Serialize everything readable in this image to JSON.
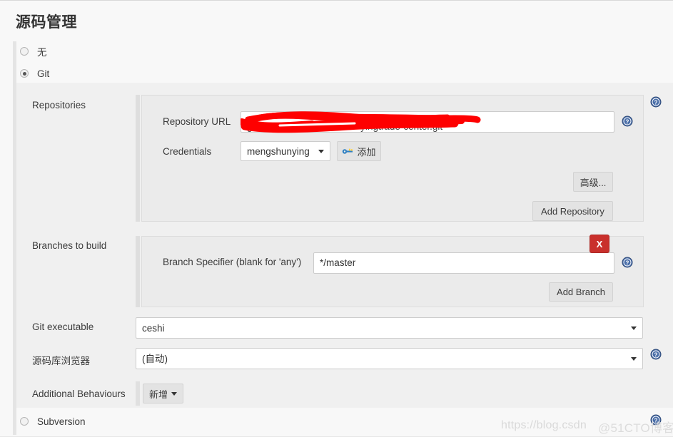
{
  "page": {
    "title": "源码管理"
  },
  "scm_options": [
    {
      "label": "无",
      "checked": false
    },
    {
      "label": "Git",
      "checked": true
    },
    {
      "label": "Subversion",
      "checked": false
    }
  ],
  "git": {
    "repositories_label": "Repositories",
    "repository": {
      "url_label": "Repository URL",
      "url_value": "git@*************************yingtrade-center.git",
      "url_redacted": true,
      "credentials_label": "Credentials",
      "credentials_value": "mengshunying",
      "add_credentials_label": "添加",
      "add_credentials_icon": "key-icon",
      "advanced_label": "高级...",
      "add_repository_label": "Add Repository"
    },
    "branches": {
      "section_label": "Branches to build",
      "specifier_label": "Branch Specifier (blank for 'any')",
      "specifier_value": "*/master",
      "delete_label": "X",
      "add_branch_label": "Add Branch"
    },
    "git_executable": {
      "label": "Git executable",
      "value": "ceshi"
    },
    "repository_browser": {
      "label": "源码库浏览器",
      "value": "(自动)"
    },
    "additional_behaviours": {
      "label": "Additional Behaviours",
      "add_label": "新增"
    }
  },
  "help_icon_name": "help-icon",
  "watermark": {
    "left_text": "https://blog.csdn",
    "right_text": "@51CTO博客"
  },
  "colors": {
    "danger": "#c9302c",
    "help_blue": "#3c5a8a",
    "redaction": "#fe0000",
    "panel": "#f0f0f0",
    "page_bg": "#f8f8f8"
  }
}
